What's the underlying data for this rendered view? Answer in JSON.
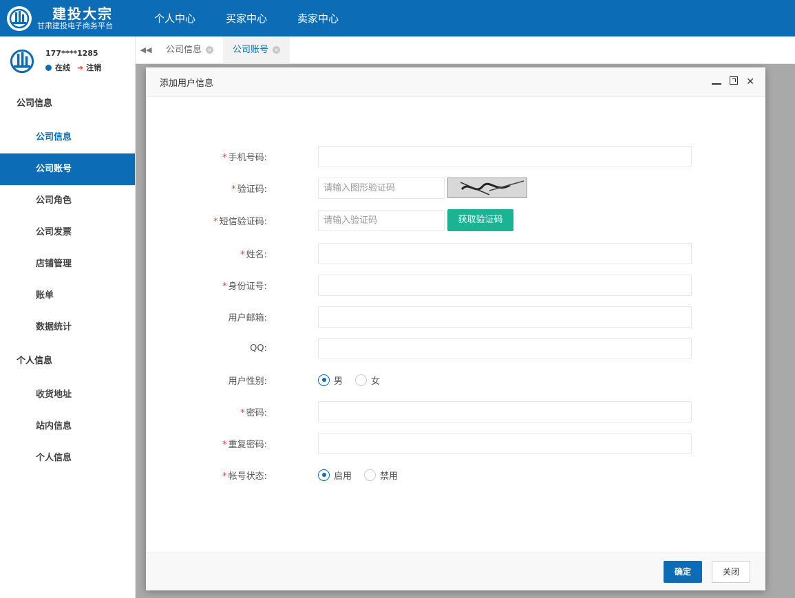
{
  "brand": {
    "title": "建投大宗",
    "subtitle": "甘肃建投电子商务平台"
  },
  "topnav": [
    "个人中心",
    "买家中心",
    "卖家中心"
  ],
  "user": {
    "phone": "177****1285",
    "status": "在线",
    "logout": "注销"
  },
  "sidebar": {
    "group1": "公司信息",
    "group1_items": [
      "公司信息",
      "公司账号",
      "公司角色",
      "公司发票",
      "店铺管理",
      "账单",
      "数据统计"
    ],
    "group2": "个人信息",
    "group2_items": [
      "收货地址",
      "站内信息",
      "个人信息"
    ]
  },
  "tabs": [
    {
      "label": "公司信息"
    },
    {
      "label": "公司账号"
    }
  ],
  "modal": {
    "title": "添加用户信息",
    "fields": {
      "phone": {
        "label": "手机号码:",
        "value": ""
      },
      "captcha": {
        "label": "验证码:",
        "placeholder": "请输入图形验证码"
      },
      "sms": {
        "label": "短信验证码:",
        "placeholder": "请输入验证码",
        "button": "获取验证码"
      },
      "name": {
        "label": "姓名:",
        "value": ""
      },
      "idcard": {
        "label": "身份证号:",
        "value": ""
      },
      "email": {
        "label": "用户邮箱:",
        "value": ""
      },
      "qq": {
        "label": "QQ:",
        "value": ""
      },
      "gender": {
        "label": "用户性别:",
        "options": [
          "男",
          "女"
        ],
        "selected": "男"
      },
      "password": {
        "label": "密码:",
        "value": ""
      },
      "password2": {
        "label": "重复密码:",
        "value": ""
      },
      "status": {
        "label": "帐号状态:",
        "options": [
          "启用",
          "禁用"
        ],
        "selected": "启用"
      }
    },
    "ok": "确定",
    "close": "关闭"
  },
  "colors": {
    "primary": "#0c6cb5",
    "green": "#1ab394",
    "required": "#e84c3d"
  }
}
